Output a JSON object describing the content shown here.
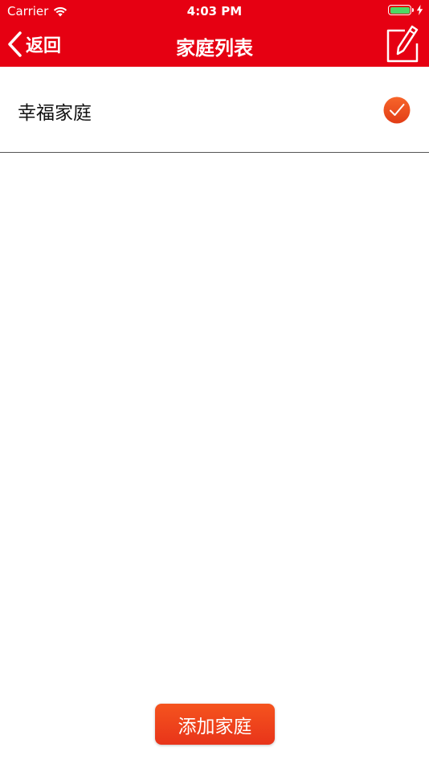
{
  "status_bar": {
    "carrier": "Carrier",
    "time": "4:03 PM"
  },
  "nav": {
    "back_label": "返回",
    "title": "家庭列表"
  },
  "family_list": [
    {
      "name": "幸福家庭",
      "selected": true
    }
  ],
  "add_button_label": "添加家庭",
  "colors": {
    "brand_red": "#e60012",
    "check_orange": "#f0521f",
    "button_orange": "#f5541e",
    "battery_green": "#4cd964"
  },
  "icons": [
    "wifi-icon",
    "battery-icon",
    "charging-bolt-icon",
    "chevron-left-icon",
    "edit-pencil-icon",
    "check-circle-icon"
  ]
}
